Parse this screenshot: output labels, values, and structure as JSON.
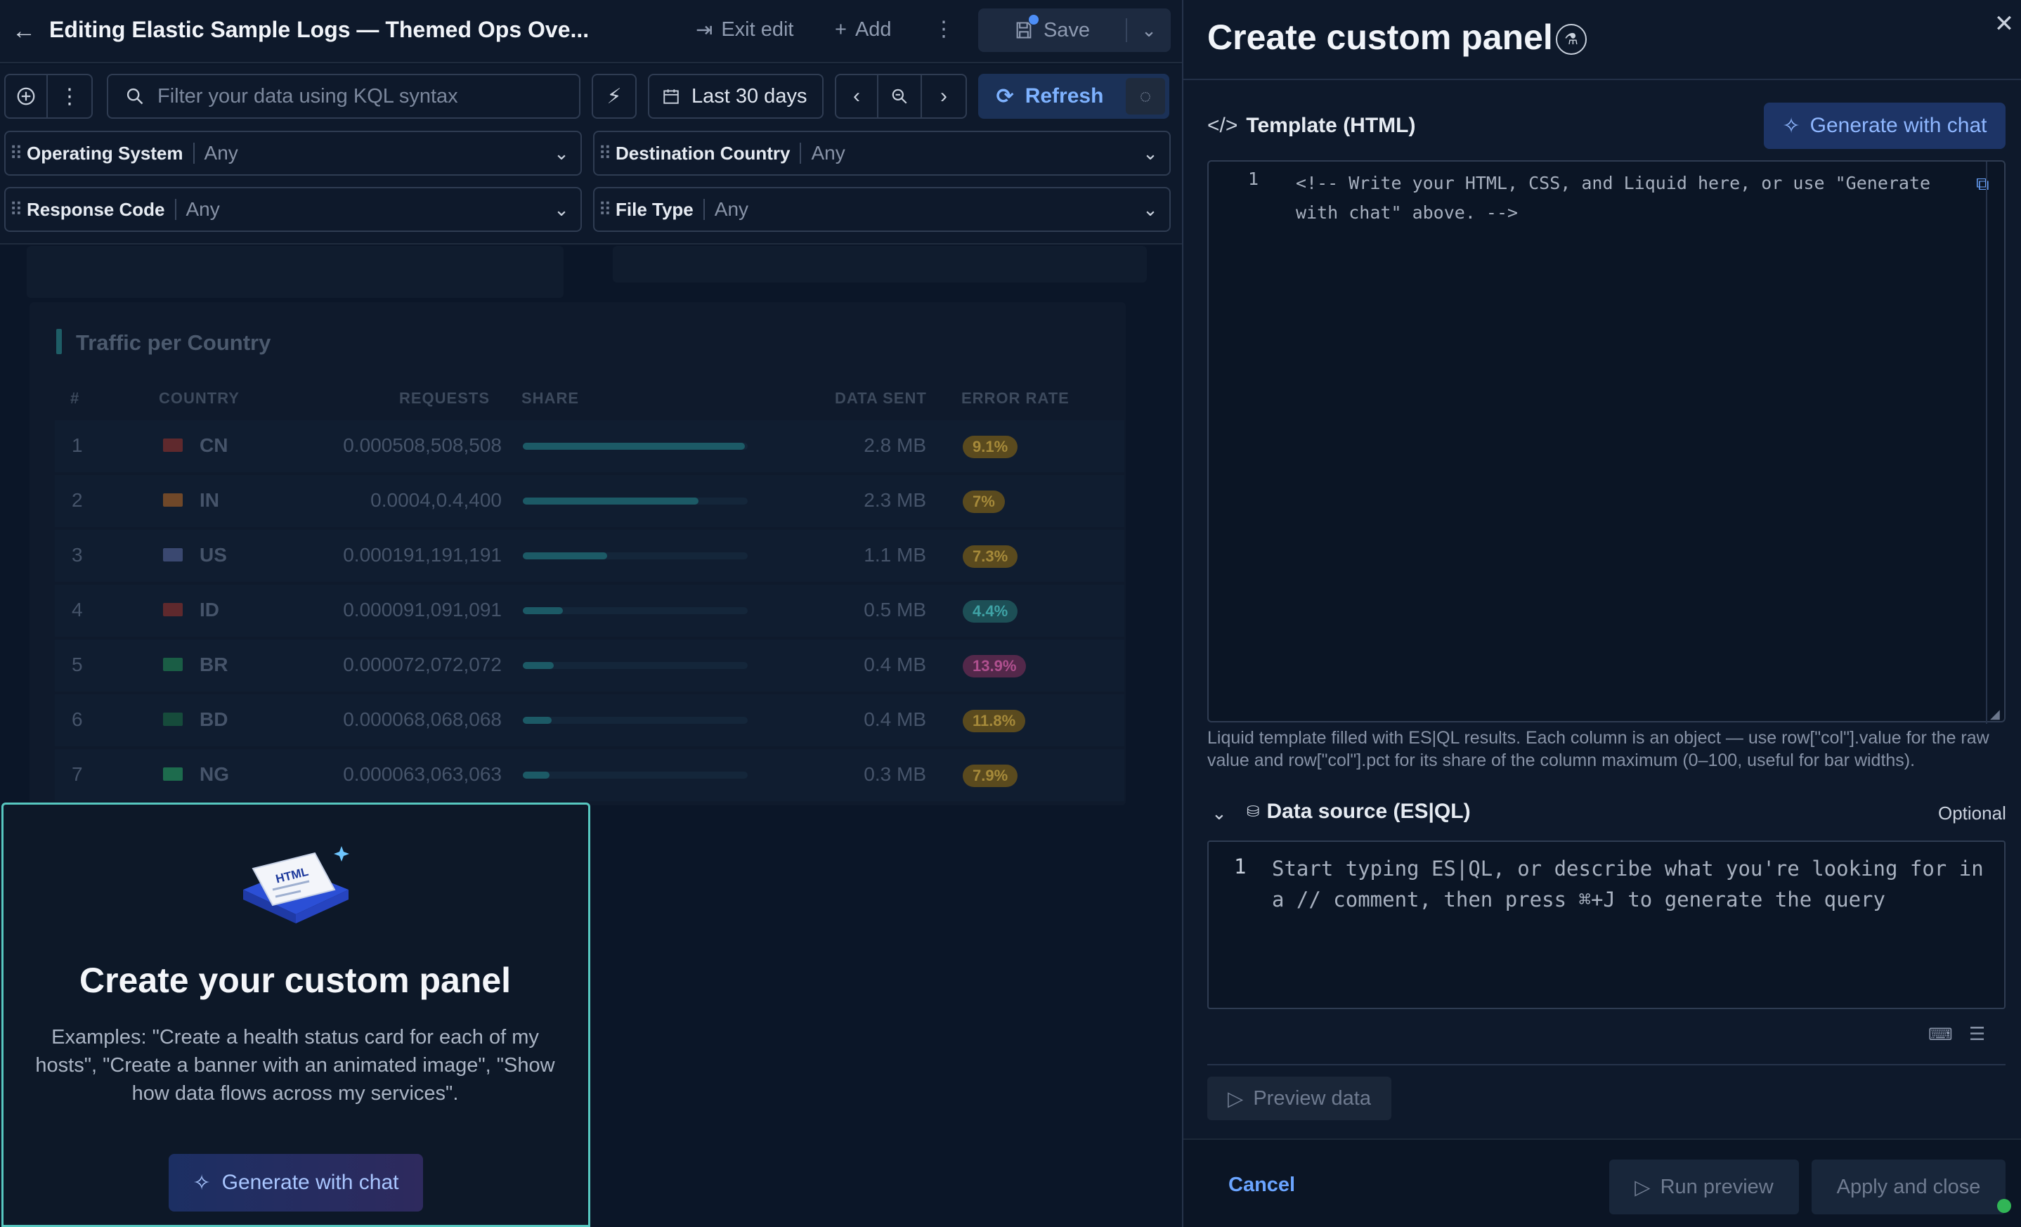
{
  "dashboard": {
    "title": "Editing Elastic Sample Logs — Themed Ops Ove...",
    "exit_edit": "Exit edit",
    "add": "Add",
    "save": "Save"
  },
  "querybar": {
    "search_placeholder": "Filter your data using KQL syntax",
    "date_range": "Last 30 days",
    "refresh": "Refresh"
  },
  "controls": [
    {
      "label": "Operating System",
      "value": "Any"
    },
    {
      "label": "Destination Country",
      "value": "Any"
    },
    {
      "label": "Response Code",
      "value": "Any"
    },
    {
      "label": "File Type",
      "value": "Any"
    }
  ],
  "traffic_panel": {
    "title": "Traffic per Country",
    "headers": [
      "#",
      "COUNTRY",
      "REQUESTS",
      "SHARE",
      "DATA SENT",
      "ERROR RATE"
    ],
    "rows": [
      {
        "rank": "1",
        "country": "CN",
        "requests": "0.000508,508,508",
        "share": 1.0,
        "data_sent": "2.8 MB",
        "error_rate": "9.1%",
        "badge_color": "#5a4a1e",
        "badge_text": "#a68a3a",
        "flag_color": "#c0392b"
      },
      {
        "rank": "2",
        "country": "IN",
        "requests": "0.0004,0.4,400",
        "share": 0.79,
        "data_sent": "2.3 MB",
        "error_rate": "7%",
        "badge_color": "#5a4a1e",
        "badge_text": "#a68a3a",
        "flag_color": "#e67e22"
      },
      {
        "rank": "3",
        "country": "US",
        "requests": "0.000191,191,191",
        "share": 0.38,
        "data_sent": "1.1 MB",
        "error_rate": "7.3%",
        "badge_color": "#5a4a1e",
        "badge_text": "#a68a3a",
        "flag_color": "#6f7fbf"
      },
      {
        "rank": "4",
        "country": "ID",
        "requests": "0.000091,091,091",
        "share": 0.18,
        "data_sent": "0.5 MB",
        "error_rate": "4.4%",
        "badge_color": "#1d4f56",
        "badge_text": "#3fa3a6",
        "flag_color": "#c0392b"
      },
      {
        "rank": "5",
        "country": "BR",
        "requests": "0.000072,072,072",
        "share": 0.14,
        "data_sent": "0.4 MB",
        "error_rate": "13.9%",
        "badge_color": "#53284a",
        "badge_text": "#b0508f",
        "flag_color": "#27ae60"
      },
      {
        "rank": "6",
        "country": "BD",
        "requests": "0.000068,068,068",
        "share": 0.13,
        "data_sent": "0.4 MB",
        "error_rate": "11.8%",
        "badge_color": "#5a4a1e",
        "badge_text": "#a68a3a",
        "flag_color": "#1e8449"
      },
      {
        "rank": "7",
        "country": "NG",
        "requests": "0.000063,063,063",
        "share": 0.12,
        "data_sent": "0.3 MB",
        "error_rate": "7.9%",
        "badge_color": "#5a4a1e",
        "badge_text": "#a68a3a",
        "flag_color": "#2ecc71"
      }
    ]
  },
  "empty_panel": {
    "illustration_text": "HTML",
    "title": "Create your custom panel",
    "examples": "Examples: \"Create a health status card for each of my hosts\", \"Create a banner with an animated image\", \"Show how data flows across my services\".",
    "generate": "Generate with chat"
  },
  "flyout": {
    "title": "Create custom panel",
    "template_code_icon": "</>",
    "template_label": "Template (HTML)",
    "generate_with_chat": "Generate with chat",
    "editor_line": "1",
    "editor_text": "<!-- Write your HTML, CSS, and Liquid here, or use \"Generate with chat\" above. -->",
    "help_text": "Liquid template filled with ES|QL results. Each column is an object — use row[\"col\"].value for the raw value and row[\"col\"].pct for its share of the column maximum (0–100, useful for bar widths).",
    "data_source_label": "Data source (ES|QL)",
    "optional": "Optional",
    "esql_line": "1",
    "esql_placeholder": "Start typing ES|QL, or describe what you're looking for in a // comment, then press ⌘+J to generate the query",
    "preview_data": "Preview data",
    "cancel": "Cancel",
    "run_preview": "Run preview",
    "apply_close": "Apply and close"
  },
  "colors": {
    "accent": "#4d8ef7",
    "panel_border": "#57c7c0",
    "status_ok": "#31b556"
  }
}
